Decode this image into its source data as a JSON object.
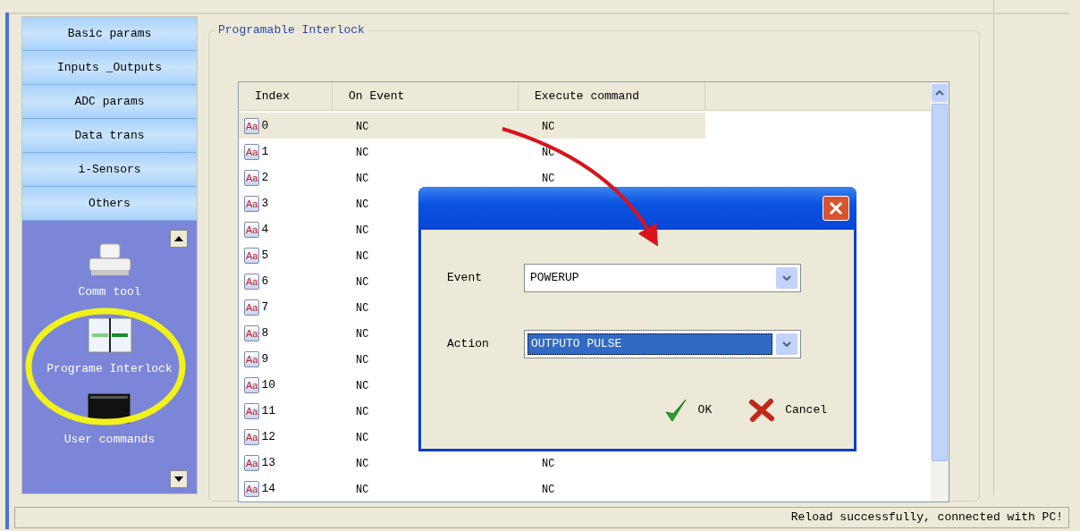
{
  "sidebar": {
    "categories": [
      {
        "label": "Basic params"
      },
      {
        "label": "Inputs _Outputs"
      },
      {
        "label": "ADC params"
      },
      {
        "label": "Data trans"
      },
      {
        "label": "i-Sensors"
      },
      {
        "label": "Others"
      }
    ],
    "tools": [
      {
        "label": "Comm tool",
        "kind": "printer"
      },
      {
        "label": "Programe Interlock",
        "kind": "interlock"
      },
      {
        "label": "User commands",
        "kind": "terminal"
      }
    ]
  },
  "group": {
    "title": "Programable Interlock"
  },
  "table": {
    "columns": [
      "Index",
      "On Event",
      "Execute command"
    ],
    "rows": [
      {
        "icon_text": "Aa",
        "index": "0",
        "on_event": "NC",
        "execute_command": "NC",
        "selected": true
      },
      {
        "icon_text": "Aa",
        "index": "1",
        "on_event": "NC",
        "execute_command": "NC",
        "selected": false
      },
      {
        "icon_text": "Aa",
        "index": "2",
        "on_event": "NC",
        "execute_command": "NC",
        "selected": false
      },
      {
        "icon_text": "Aa",
        "index": "3",
        "on_event": "NC",
        "selected": false
      },
      {
        "icon_text": "Aa",
        "index": "4",
        "on_event": "NC",
        "selected": false
      },
      {
        "icon_text": "Aa",
        "index": "5",
        "on_event": "NC",
        "selected": false
      },
      {
        "icon_text": "Aa",
        "index": "6",
        "on_event": "NC",
        "selected": false
      },
      {
        "icon_text": "Aa",
        "index": "7",
        "on_event": "NC",
        "selected": false
      },
      {
        "icon_text": "Aa",
        "index": "8",
        "on_event": "NC",
        "selected": false
      },
      {
        "icon_text": "Aa",
        "index": "9",
        "on_event": "NC",
        "selected": false
      },
      {
        "icon_text": "Aa",
        "index": "10",
        "on_event": "NC",
        "selected": false
      },
      {
        "icon_text": "Aa",
        "index": "11",
        "on_event": "NC",
        "selected": false
      },
      {
        "icon_text": "Aa",
        "index": "12",
        "on_event": "NC",
        "selected": false
      },
      {
        "icon_text": "Aa",
        "index": "13",
        "on_event": "NC",
        "execute_command": "NC",
        "selected": false
      },
      {
        "icon_text": "Aa",
        "index": "14",
        "on_event": "NC",
        "execute_command": "NC",
        "selected": false
      }
    ]
  },
  "dialog": {
    "fields": [
      {
        "label": "Event",
        "value": "POWERUP",
        "selected": false
      },
      {
        "label": "Action",
        "value": "OUTPUTO PULSE",
        "selected": true
      }
    ],
    "buttons": [
      {
        "label": "OK",
        "kind": "ok"
      },
      {
        "label": "Cancel",
        "kind": "cancel"
      }
    ]
  },
  "status_bar": {
    "text": "Reload successfully, connected with PC!"
  }
}
